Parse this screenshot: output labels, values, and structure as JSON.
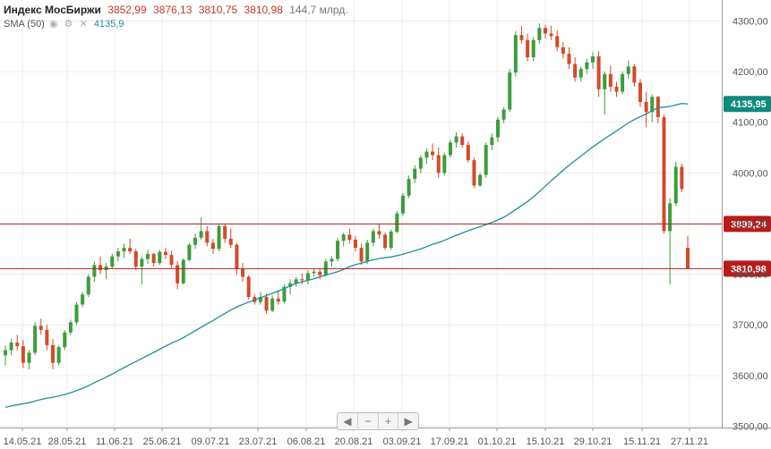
{
  "legend": {
    "title": "Индекс МосБиржи",
    "open": "3852,99",
    "high": "3876,13",
    "low": "3810,75",
    "close": "3810,98",
    "volume": "144,7 млрд.",
    "sma_label": "SMA (50)",
    "sma_value": "4135,9"
  },
  "nav": {
    "prev": "◀",
    "zoom_out": "−",
    "zoom_in": "+",
    "next": "▶"
  },
  "colors": {
    "up": "#3c9d3c",
    "down": "#d44a2c",
    "sma": "#1e8e9a",
    "level": "#b71c1c",
    "badge_green": "#0e8a7e"
  },
  "chart_data": {
    "type": "candlestick",
    "yticks": [
      "3500,00",
      "3600,00",
      "3700,00",
      "3800,00",
      "3900,00",
      "4000,00",
      "4100,00",
      "4200,00",
      "4300,00"
    ],
    "ylim": [
      3500,
      4310
    ],
    "xticks": [
      "14.05.21",
      "28.05.21",
      "11.06.21",
      "25.06.21",
      "09.07.21",
      "23.07.21",
      "06.08.21",
      "20.08.21",
      "03.09.21",
      "17.09.21",
      "01.10.21",
      "15.10.21",
      "29.10.21",
      "15.11.21",
      "27.11.21"
    ],
    "horizontal_lines": [
      {
        "value": 3899.24,
        "label": "3899,24"
      },
      {
        "value": 3810.98,
        "label": "3810,98"
      }
    ],
    "sma": {
      "name": "SMA (50)",
      "last_label": "4135,95",
      "last": 4135.95
    },
    "candles": [
      [
        3640,
        3660,
        3620,
        3650
      ],
      [
        3650,
        3672,
        3640,
        3665
      ],
      [
        3665,
        3680,
        3650,
        3658
      ],
      [
        3658,
        3670,
        3615,
        3625
      ],
      [
        3625,
        3650,
        3612,
        3645
      ],
      [
        3645,
        3705,
        3640,
        3698
      ],
      [
        3698,
        3712,
        3680,
        3690
      ],
      [
        3690,
        3700,
        3650,
        3660
      ],
      [
        3660,
        3672,
        3612,
        3625
      ],
      [
        3625,
        3660,
        3620,
        3656
      ],
      [
        3656,
        3690,
        3650,
        3685
      ],
      [
        3685,
        3710,
        3680,
        3705
      ],
      [
        3705,
        3745,
        3700,
        3740
      ],
      [
        3740,
        3765,
        3735,
        3760
      ],
      [
        3760,
        3800,
        3755,
        3795
      ],
      [
        3795,
        3825,
        3785,
        3818
      ],
      [
        3818,
        3835,
        3800,
        3808
      ],
      [
        3808,
        3822,
        3790,
        3815
      ],
      [
        3815,
        3840,
        3810,
        3835
      ],
      [
        3835,
        3852,
        3825,
        3845
      ],
      [
        3845,
        3860,
        3832,
        3852
      ],
      [
        3852,
        3870,
        3840,
        3845
      ],
      [
        3845,
        3850,
        3808,
        3815
      ],
      [
        3815,
        3835,
        3780,
        3830
      ],
      [
        3830,
        3848,
        3820,
        3840
      ],
      [
        3840,
        3842,
        3815,
        3822
      ],
      [
        3822,
        3848,
        3818,
        3844
      ],
      [
        3844,
        3852,
        3830,
        3838
      ],
      [
        3838,
        3846,
        3812,
        3818
      ],
      [
        3818,
        3826,
        3770,
        3782
      ],
      [
        3782,
        3832,
        3780,
        3828
      ],
      [
        3828,
        3862,
        3825,
        3858
      ],
      [
        3858,
        3880,
        3850,
        3872
      ],
      [
        3872,
        3912,
        3868,
        3885
      ],
      [
        3885,
        3895,
        3855,
        3862
      ],
      [
        3862,
        3870,
        3840,
        3850
      ],
      [
        3850,
        3900,
        3845,
        3895
      ],
      [
        3895,
        3900,
        3862,
        3870
      ],
      [
        3870,
        3890,
        3852,
        3858
      ],
      [
        3858,
        3862,
        3798,
        3810
      ],
      [
        3810,
        3822,
        3785,
        3795
      ],
      [
        3795,
        3798,
        3750,
        3755
      ],
      [
        3755,
        3760,
        3740,
        3745
      ],
      [
        3745,
        3765,
        3740,
        3755
      ],
      [
        3755,
        3762,
        3722,
        3728
      ],
      [
        3728,
        3758,
        3725,
        3752
      ],
      [
        3752,
        3768,
        3740,
        3746
      ],
      [
        3746,
        3780,
        3742,
        3775
      ],
      [
        3775,
        3790,
        3760,
        3782
      ],
      [
        3782,
        3795,
        3775,
        3790
      ],
      [
        3790,
        3802,
        3780,
        3788
      ],
      [
        3788,
        3808,
        3780,
        3802
      ],
      [
        3802,
        3812,
        3795,
        3805
      ],
      [
        3805,
        3812,
        3790,
        3798
      ],
      [
        3798,
        3830,
        3795,
        3825
      ],
      [
        3825,
        3835,
        3815,
        3830
      ],
      [
        3830,
        3872,
        3825,
        3866
      ],
      [
        3866,
        3882,
        3855,
        3878
      ],
      [
        3878,
        3890,
        3860,
        3868
      ],
      [
        3868,
        3875,
        3845,
        3852
      ],
      [
        3852,
        3860,
        3818,
        3825
      ],
      [
        3825,
        3868,
        3820,
        3862
      ],
      [
        3862,
        3890,
        3855,
        3885
      ],
      [
        3885,
        3900,
        3870,
        3878
      ],
      [
        3878,
        3882,
        3848,
        3852
      ],
      [
        3852,
        3888,
        3848,
        3884
      ],
      [
        3884,
        3925,
        3880,
        3920
      ],
      [
        3920,
        3960,
        3915,
        3955
      ],
      [
        3955,
        3995,
        3950,
        3988
      ],
      [
        3988,
        4015,
        3980,
        4008
      ],
      [
        4008,
        4035,
        4000,
        4030
      ],
      [
        4030,
        4048,
        4018,
        4042
      ],
      [
        4042,
        4058,
        4025,
        4035
      ],
      [
        4035,
        4050,
        3990,
        4000
      ],
      [
        4000,
        4040,
        3995,
        4035
      ],
      [
        4035,
        4065,
        4030,
        4060
      ],
      [
        4060,
        4080,
        4050,
        4072
      ],
      [
        4072,
        4078,
        4050,
        4055
      ],
      [
        4055,
        4062,
        4020,
        4025
      ],
      [
        4025,
        4030,
        3970,
        3975
      ],
      [
        3975,
        4000,
        3972,
        3996
      ],
      [
        3996,
        4060,
        3990,
        4055
      ],
      [
        4055,
        4078,
        4045,
        4070
      ],
      [
        4070,
        4110,
        4060,
        4105
      ],
      [
        4105,
        4130,
        4098,
        4125
      ],
      [
        4125,
        4205,
        4120,
        4198
      ],
      [
        4198,
        4280,
        4190,
        4272
      ],
      [
        4272,
        4290,
        4255,
        4262
      ],
      [
        4262,
        4275,
        4220,
        4228
      ],
      [
        4228,
        4268,
        4220,
        4262
      ],
      [
        4262,
        4295,
        4255,
        4286
      ],
      [
        4286,
        4292,
        4265,
        4275
      ],
      [
        4275,
        4290,
        4262,
        4270
      ],
      [
        4270,
        4282,
        4240,
        4248
      ],
      [
        4248,
        4258,
        4225,
        4235
      ],
      [
        4235,
        4248,
        4205,
        4215
      ],
      [
        4215,
        4228,
        4180,
        4188
      ],
      [
        4188,
        4210,
        4180,
        4205
      ],
      [
        4205,
        4225,
        4195,
        4218
      ],
      [
        4218,
        4238,
        4205,
        4230
      ],
      [
        4230,
        4240,
        4150,
        4165
      ],
      [
        4165,
        4200,
        4115,
        4195
      ],
      [
        4195,
        4212,
        4160,
        4170
      ],
      [
        4170,
        4180,
        4150,
        4160
      ],
      [
        4160,
        4200,
        4155,
        4195
      ],
      [
        4195,
        4222,
        4185,
        4210
      ],
      [
        4210,
        4215,
        4170,
        4178
      ],
      [
        4178,
        4185,
        4130,
        4140
      ],
      [
        4140,
        4160,
        4090,
        4120
      ],
      [
        4120,
        4155,
        4100,
        4150
      ],
      [
        4150,
        4152,
        4098,
        4110
      ],
      [
        4110,
        4115,
        3880,
        3885
      ],
      [
        3885,
        3950,
        3780,
        3940
      ],
      [
        3940,
        4022,
        3935,
        4012
      ],
      [
        4012,
        4018,
        3962,
        3968
      ],
      [
        3852,
        3876,
        3810,
        3811
      ]
    ]
  }
}
